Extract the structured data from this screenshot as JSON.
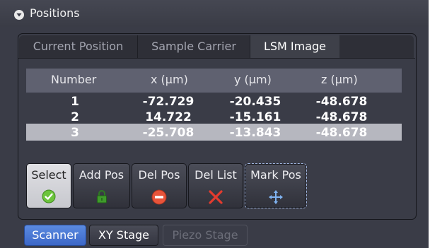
{
  "panel": {
    "title": "Positions"
  },
  "tabs": [
    {
      "label": "Current Position",
      "active": false
    },
    {
      "label": "Sample Carrier",
      "active": false
    },
    {
      "label": "LSM Image",
      "active": true
    }
  ],
  "table": {
    "headers": [
      "Number",
      "x (µm)",
      "y (µm)",
      "z (µm)"
    ],
    "rows": [
      {
        "number": "1",
        "x": "-72.729",
        "y": "-20.435",
        "z": "-48.678"
      },
      {
        "number": "2",
        "x": "14.722",
        "y": "-15.161",
        "z": "-48.678"
      },
      {
        "number": "3",
        "x": "-25.708",
        "y": "-13.843",
        "z": "-48.678"
      }
    ],
    "selected_row": 3
  },
  "buttons": {
    "select": {
      "label": "Select",
      "icon": "checkmark-icon"
    },
    "add_pos": {
      "label": "Add Pos",
      "icon": "lock-icon"
    },
    "del_pos": {
      "label": "Del Pos",
      "icon": "minus-circle-icon"
    },
    "del_list": {
      "label": "Del List",
      "icon": "x-icon"
    },
    "mark_pos": {
      "label": "Mark Pos",
      "icon": "move-arrows-icon"
    }
  },
  "stage_buttons": [
    {
      "label": "Scanner",
      "state": "active"
    },
    {
      "label": "XY Stage",
      "state": "normal"
    },
    {
      "label": "Piezo Stage",
      "state": "disabled"
    }
  ],
  "colors": {
    "panel_bg": "#3a3c47",
    "accent_blue": "#4a79d6",
    "selected_row": "#b6b7bf",
    "delete_red": "#e8543a",
    "confirm_green": "#6cc43c"
  }
}
